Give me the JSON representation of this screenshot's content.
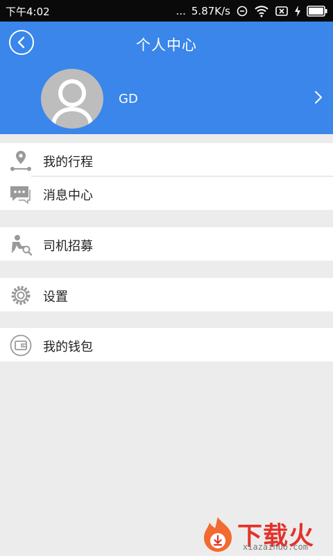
{
  "status_bar": {
    "time": "下午4:02",
    "net_speed": "5.87K/s",
    "dots": "..."
  },
  "header": {
    "title": "个人中心"
  },
  "profile": {
    "name": "GD"
  },
  "menu": {
    "trips": "我的行程",
    "messages": "消息中心",
    "driver_recruit": "司机招募",
    "settings": "设置",
    "wallet": "我的钱包"
  },
  "colors": {
    "header_bg": "#3a86ea",
    "page_bg": "#ececec",
    "icon_gray": "#9a9a9a"
  },
  "watermark": {
    "brand": "下载火",
    "domain": "xiazaihuo.com"
  }
}
